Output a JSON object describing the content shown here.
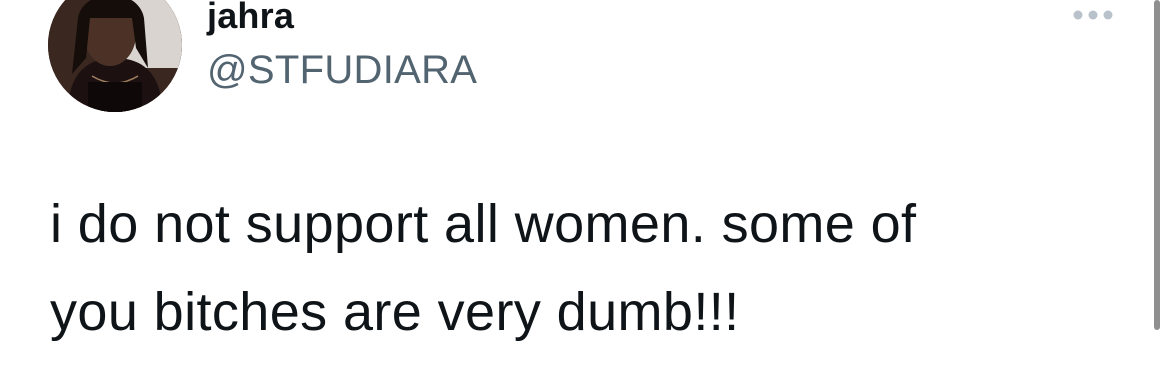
{
  "tweet": {
    "display_name": "jahra",
    "handle": "@STFUDIARA",
    "text": "i do not support all women. some of\nyou bitches are very dumb!!!"
  },
  "icons": {
    "more": "more-horizontal-icon",
    "avatar": "profile-photo"
  },
  "colors": {
    "text_primary": "#0f1419",
    "text_secondary": "#536471",
    "icon_muted": "#b9c2ca",
    "background": "#ffffff"
  }
}
